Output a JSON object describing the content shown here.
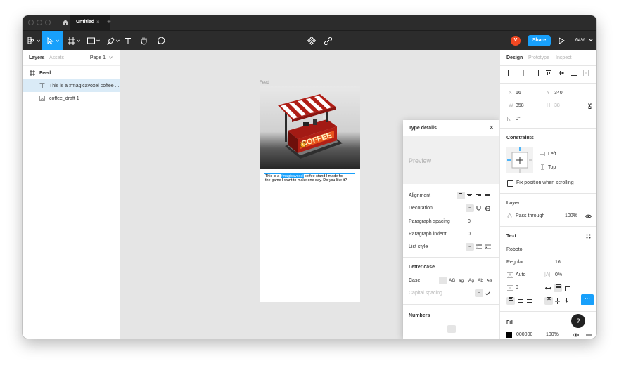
{
  "titlebar": {
    "tab_title": "Untitled",
    "tab_close": "×",
    "tab_add": "+"
  },
  "toolbar": {
    "avatar_initial": "V",
    "share_label": "Share",
    "zoom": "64%"
  },
  "left_panel": {
    "tabs": [
      "Layers",
      "Assets"
    ],
    "page_selector": "Page 1",
    "layers": [
      {
        "name": "Feed",
        "type": "frame"
      },
      {
        "name": "This is a #magicavoxel coffee ...",
        "type": "text"
      },
      {
        "name": "coffee_draft 1",
        "type": "image"
      }
    ]
  },
  "canvas": {
    "frame_label": "Feed",
    "sign_text": "COFFEE",
    "text_line1_pre": "This is a ",
    "text_highlight": "#magicavoxel",
    "text_line1_post": " coffee stand I made for",
    "text_line2": "the game I want to make one day. Do you like it?"
  },
  "type_details": {
    "title": "Type details",
    "close": "×",
    "preview": "Preview",
    "rows": [
      {
        "label": "Alignment"
      },
      {
        "label": "Decoration",
        "value": "–"
      },
      {
        "label": "Paragraph spacing",
        "value": "0"
      },
      {
        "label": "Paragraph indent",
        "value": "0"
      },
      {
        "label": "List style",
        "value": "–"
      }
    ],
    "letter_case_heading": "Letter case",
    "case_label": "Case",
    "case_dash": "–",
    "case_options": [
      "AG",
      "ag",
      "Ag",
      "Ab",
      "AG"
    ],
    "capital_spacing_label": "Capital spacing",
    "capital_dash": "–",
    "numbers_heading": "Numbers"
  },
  "right_panel": {
    "tabs": [
      "Design",
      "Prototype",
      "Inspect"
    ],
    "x_label": "X",
    "x_value": "16",
    "y_label": "Y",
    "y_value": "340",
    "w_label": "W",
    "w_value": "358",
    "h_label": "H",
    "h_value": "38",
    "rotation": "0°",
    "constraints_heading": "Constraints",
    "constraint_h": "Left",
    "constraint_v": "Top",
    "fix_position": "Fix position when scrolling",
    "layer_heading": "Layer",
    "blend_mode": "Pass through",
    "opacity": "100%",
    "text_heading": "Text",
    "font_family": "Roboto",
    "font_weight": "Regular",
    "font_size": "16",
    "line_height": "Auto",
    "letter_spacing_label": "|A|",
    "letter_spacing": "0%",
    "paragraph_spacing": "0",
    "fill_heading": "Fill",
    "fill_hex": "000000",
    "fill_opacity": "100%",
    "more": "···",
    "help": "?"
  },
  "colors": {
    "accent": "#18a0fb",
    "toolbar_bg": "#2c2c2c",
    "avatar": "#f24822",
    "canvas": "#e5e5e5"
  }
}
